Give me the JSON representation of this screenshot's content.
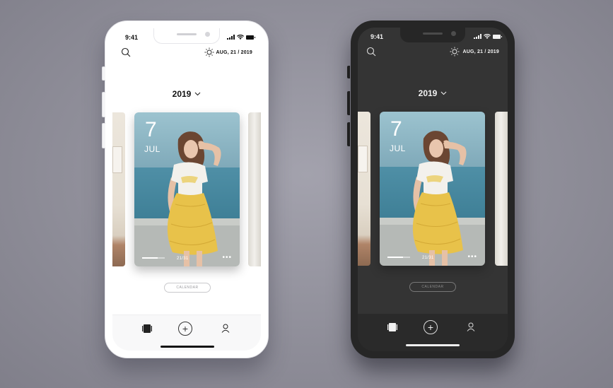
{
  "phones": [
    {
      "theme": "light",
      "status": {
        "time": "9:41"
      },
      "header": {
        "date": "AUG, 21 / 2019",
        "weather_icon": "sun-icon",
        "search_icon": "search-icon"
      },
      "year_selector": {
        "label": "2019"
      },
      "card": {
        "day": "7",
        "month": "JUL",
        "count": "21/31",
        "progress": 0.68,
        "more": "•••"
      },
      "calendar_button": "CALENDAR",
      "tabbar": {
        "items": [
          "gallery-icon",
          "add-icon",
          "profile-icon"
        ],
        "add_symbol": "+"
      }
    },
    {
      "theme": "dark",
      "status": {
        "time": "9:41"
      },
      "header": {
        "date": "AUG, 21 / 2019",
        "weather_icon": "sun-icon",
        "search_icon": "search-icon"
      },
      "year_selector": {
        "label": "2019"
      },
      "card": {
        "day": "7",
        "month": "JUL",
        "count": "21/31",
        "progress": 0.68,
        "more": "•••"
      },
      "calendar_button": "CALENDAR",
      "tabbar": {
        "items": [
          "gallery-icon",
          "add-icon",
          "profile-icon"
        ],
        "add_symbol": "+"
      }
    }
  ],
  "colors": {
    "background": "#8f8e99",
    "light_screen": "#ffffff",
    "dark_screen": "#343434",
    "photo_sky": "#7fa6b6",
    "photo_skirt": "#e8c24a"
  }
}
